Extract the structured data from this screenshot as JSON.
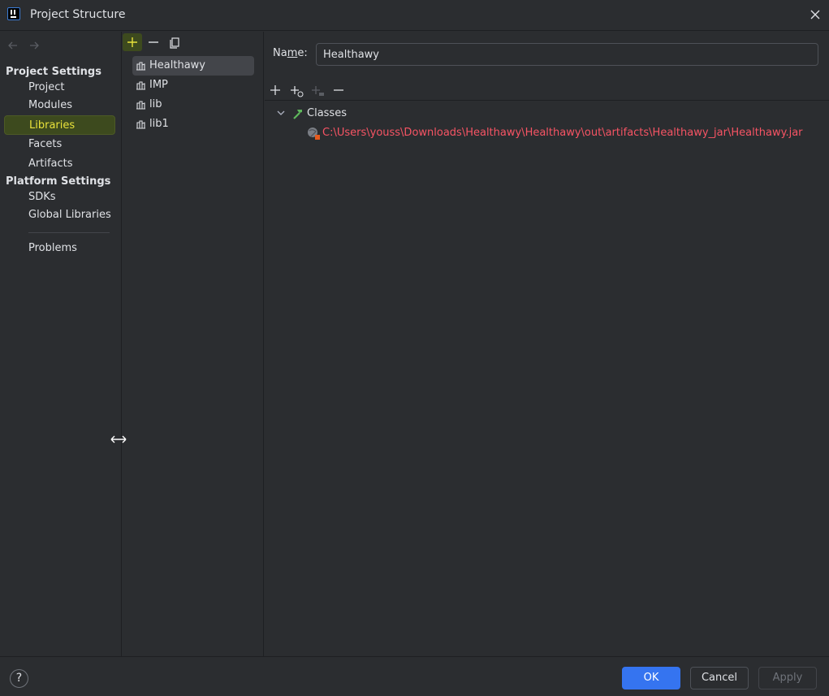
{
  "window": {
    "title": "Project Structure"
  },
  "leftnav": {
    "project_settings_label": "Project Settings",
    "project_items": [
      {
        "label": "Project"
      },
      {
        "label": "Modules"
      },
      {
        "label": "Libraries",
        "selected": true
      },
      {
        "label": "Facets"
      },
      {
        "label": "Artifacts"
      }
    ],
    "platform_settings_label": "Platform Settings",
    "platform_items": [
      {
        "label": "SDKs"
      },
      {
        "label": "Global Libraries"
      }
    ],
    "problems_label": "Problems"
  },
  "libraries": {
    "items": [
      {
        "label": "Healthawy",
        "selected": true
      },
      {
        "label": "IMP"
      },
      {
        "label": "lib"
      },
      {
        "label": "lib1"
      }
    ]
  },
  "details": {
    "name_label_prefix": "Na",
    "name_label_mnemonic": "m",
    "name_label_suffix": "e:",
    "name_value": "Healthawy",
    "classes_label": "Classes",
    "jar_path": "C:\\Users\\youss\\Downloads\\Healthawy\\Healthawy\\out\\artifacts\\Healthawy_jar\\Healthawy.jar"
  },
  "footer": {
    "help_label": "?",
    "ok_label": "OK",
    "cancel_label": "Cancel",
    "apply_label": "Apply"
  },
  "colors": {
    "background": "#2b2d30",
    "selection_highlight": "#3d4a1e",
    "selection_text": "#e8e13a",
    "error_path": "#f75464",
    "primary_button": "#3574f0"
  }
}
